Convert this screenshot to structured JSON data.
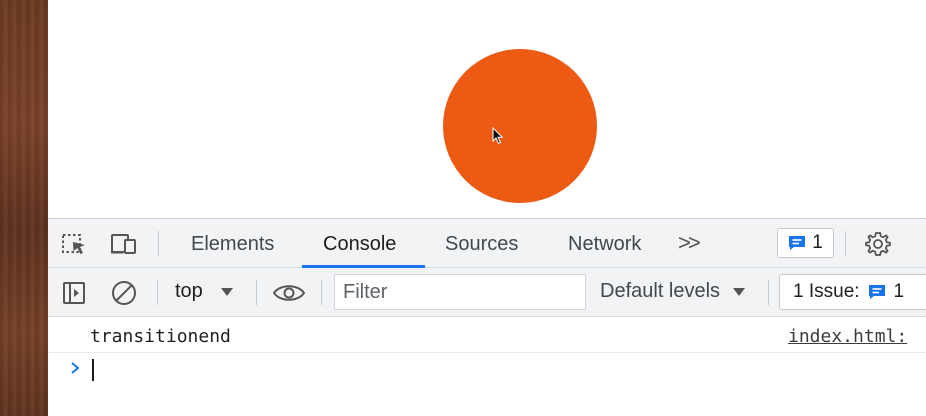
{
  "page": {
    "background_color": "#ffffff"
  },
  "viewport": {
    "circle_color": "#ec5a14"
  },
  "devtools": {
    "tabs": [
      {
        "label": "Elements",
        "active": false
      },
      {
        "label": "Console",
        "active": true
      },
      {
        "label": "Sources",
        "active": false
      },
      {
        "label": "Network",
        "active": false
      }
    ],
    "more_tabs_label": ">>",
    "messages_count": "1",
    "accent_color": "#1a73e8",
    "icons": [
      "inspect-element-icon",
      "device-toolbar-icon",
      "more-tabs-icon",
      "chat-icon",
      "gear-icon"
    ]
  },
  "console_toolbar": {
    "context": "top",
    "filter_placeholder": "Filter",
    "levels_label": "Default levels",
    "issues_label": "1 Issue:",
    "issues_count": "1",
    "icons": [
      "sidebar-toggle-icon",
      "clear-console-icon",
      "chevron-down-icon",
      "eye-icon",
      "chat-icon"
    ]
  },
  "console": {
    "messages": [
      {
        "text": "transitionend",
        "source": "index.html:"
      }
    ],
    "prompt_icon": "chevron-right-icon"
  }
}
